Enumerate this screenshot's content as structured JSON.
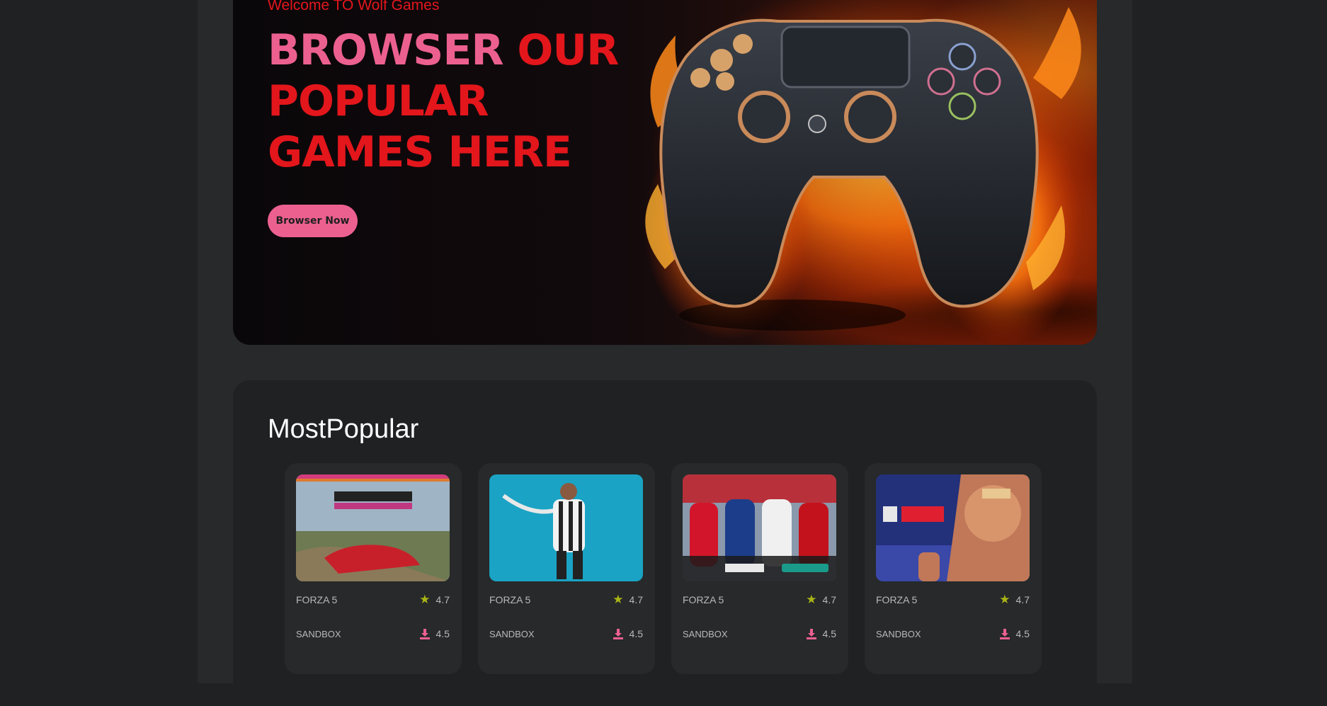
{
  "hero": {
    "welcome": "Welcome TO Wolf Games",
    "title_pink": "BROWSER",
    "title_red": "OUR POPULAR GAMES HERE",
    "button_label": "Browser Now"
  },
  "colors": {
    "accent_pink": "#ec6090",
    "accent_red": "#e3161c",
    "page_bg": "#1f2122",
    "column_bg": "#27292a",
    "rating_star": "#aab515",
    "download_icon": "#ec6090"
  },
  "most_popular": {
    "title": "MostPopular",
    "cards": [
      {
        "image": "forza-horizon-5-cover",
        "name": "FORZA 5",
        "rating": "4.7",
        "genre": "SANDBOX",
        "downloads": "4.5",
        "rating_icon": "star-icon",
        "download_icon": "download-icon"
      },
      {
        "image": "fifa-19-cover",
        "name": "FORZA 5",
        "rating": "4.7",
        "genre": "SANDBOX",
        "downloads": "4.5",
        "rating_icon": "star-icon",
        "download_icon": "download-icon"
      },
      {
        "image": "pes-2021-cover",
        "name": "FORZA 5",
        "rating": "4.7",
        "genre": "SANDBOX",
        "downloads": "4.5",
        "rating_icon": "star-icon",
        "download_icon": "download-icon"
      },
      {
        "image": "wwe-2k24-cover",
        "name": "FORZA 5",
        "rating": "4.7",
        "genre": "SANDBOX",
        "downloads": "4.5",
        "rating_icon": "star-icon",
        "download_icon": "download-icon"
      }
    ]
  }
}
